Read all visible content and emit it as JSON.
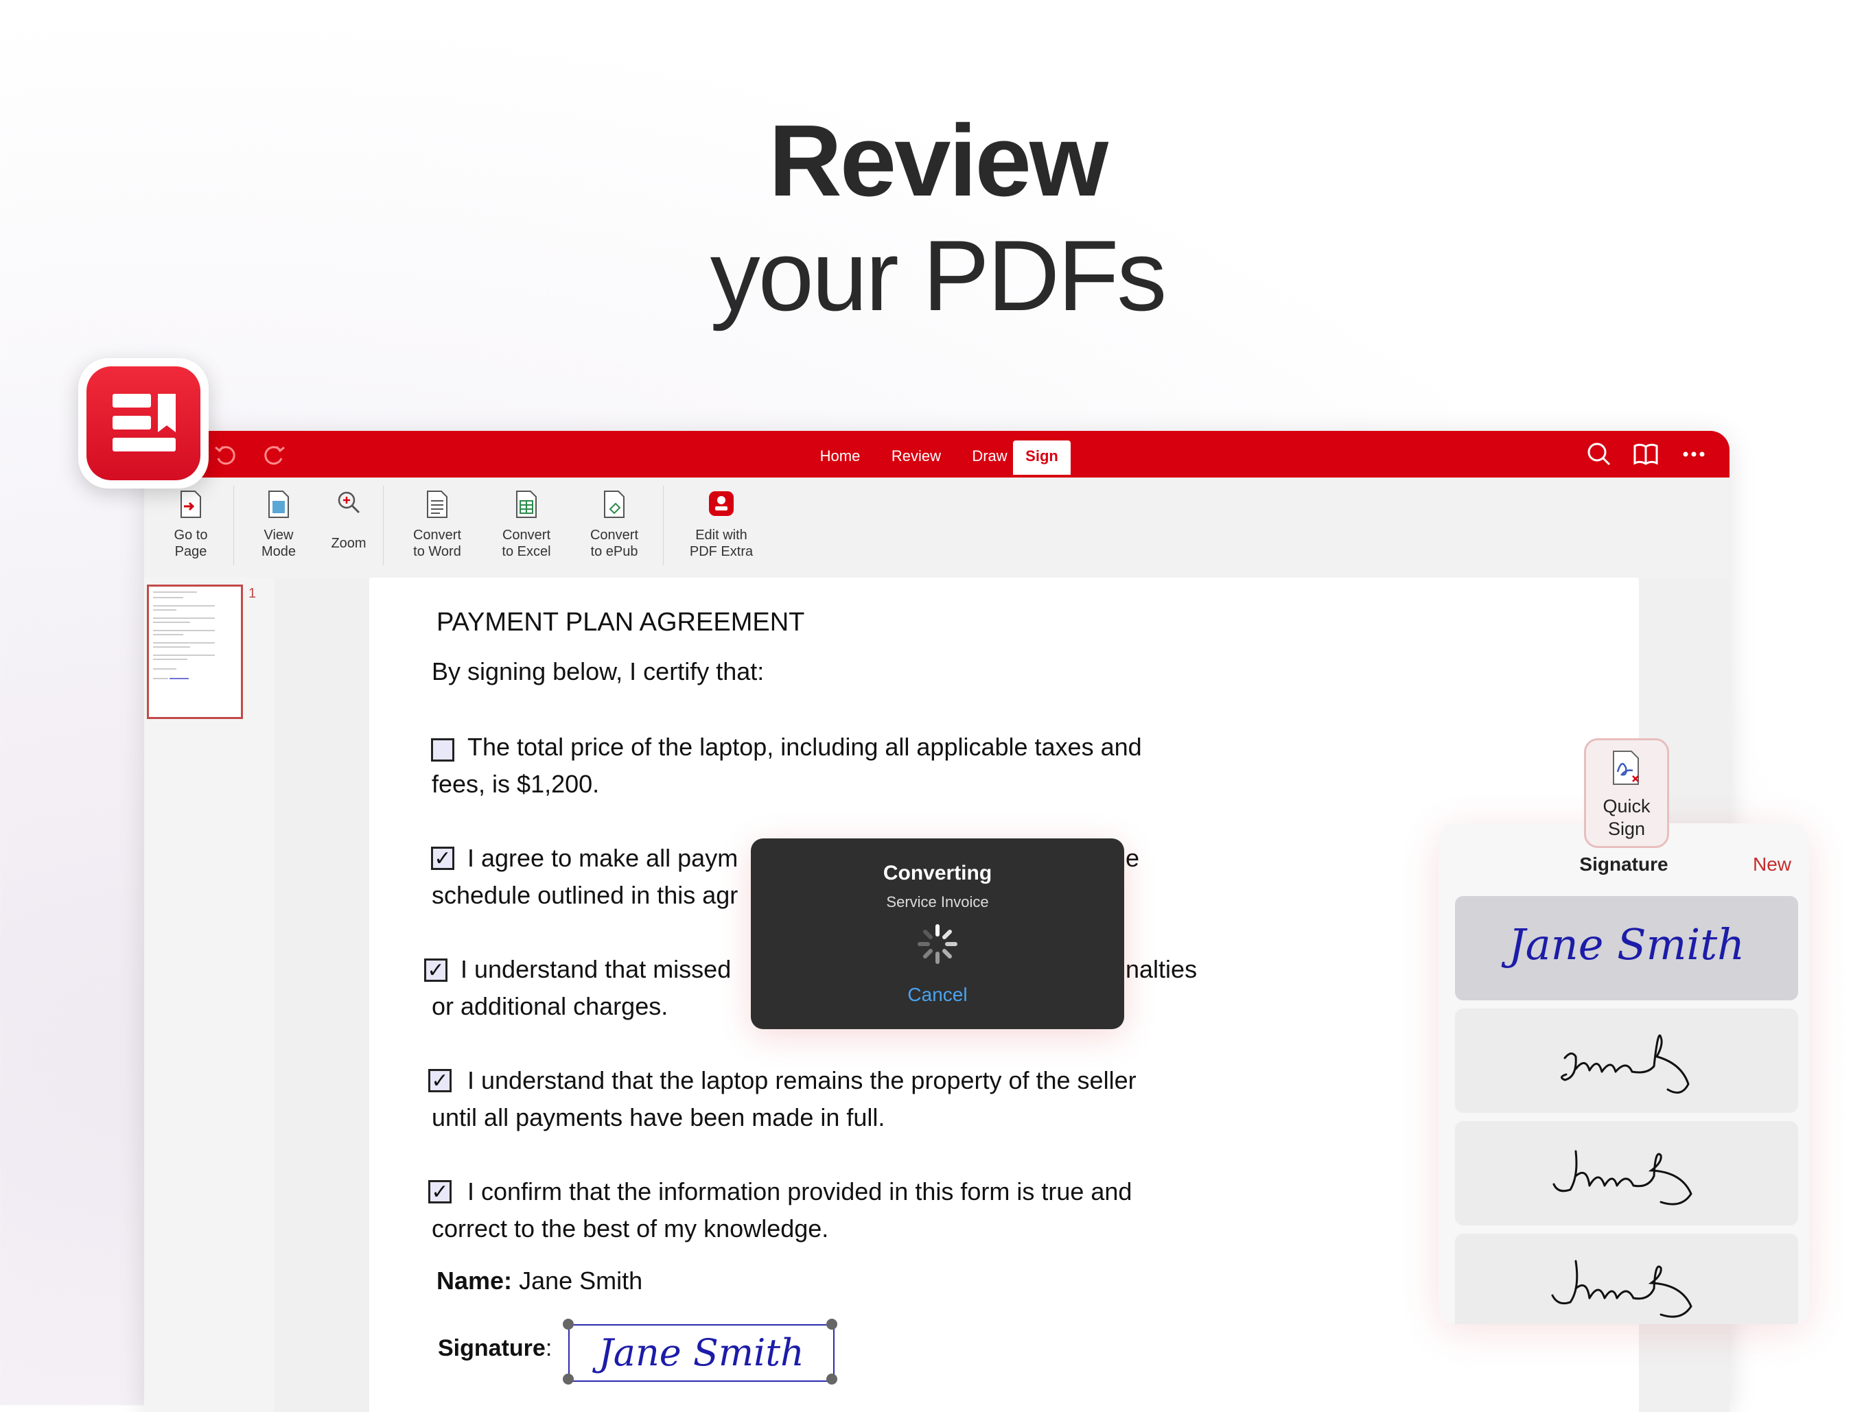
{
  "hero": {
    "title": "Review",
    "subtitle": "your PDFs"
  },
  "toolbar": {
    "tabs": [
      "Home",
      "Review",
      "Draw",
      "Sign"
    ],
    "active_tab": "Sign"
  },
  "ribbon": {
    "go_to_page": [
      "Go to",
      "Page"
    ],
    "view_mode": [
      "View",
      "Mode"
    ],
    "zoom": "Zoom",
    "convert_word": [
      "Convert",
      "to Word"
    ],
    "convert_excel": [
      "Convert",
      "to Excel"
    ],
    "convert_epub": [
      "Convert",
      "to ePub"
    ],
    "edit_pdf_extra": [
      "Edit with",
      "PDF Extra"
    ]
  },
  "thumbnail": {
    "page_number": "1"
  },
  "document": {
    "title": "PAYMENT PLAN AGREEMENT",
    "intro": "By signing below, I certify that:",
    "items": [
      {
        "checked": false,
        "line1": "The total price of the laptop, including all applicable taxes and",
        "line2": "fees, is $1,200."
      },
      {
        "checked": true,
        "line1a": "I agree to make all paym",
        "line1b": "e",
        "line2": "schedule outlined in this agr"
      },
      {
        "checked": true,
        "line1a": "I understand that missed",
        "line1b": "nalties",
        "line2": "or additional charges."
      },
      {
        "checked": true,
        "line1": "I understand that the laptop remains the property of the seller",
        "line2": "until all payments have been made in full."
      },
      {
        "checked": true,
        "line1": "I confirm that the information provided in this form is true and",
        "line2": "correct to the best of my knowledge."
      }
    ],
    "checkmark": "✓",
    "name_label": "Name:",
    "name_value": "Jane Smith",
    "signature_label": "Signature",
    "signature_colon": ":",
    "signature_value": "Jane Smith"
  },
  "converting_dialog": {
    "title": "Converting",
    "subtitle": "Service Invoice",
    "cancel": "Cancel"
  },
  "quick_sign": {
    "label": [
      "Quick",
      "Sign"
    ]
  },
  "signature_panel": {
    "title": "Signature",
    "new_label": "New",
    "selected_signature": "Jane Smith"
  },
  "colors": {
    "brand_red": "#d7000f",
    "cancel_blue": "#4aa3f0",
    "signature_ink": "#1c1ca8"
  }
}
